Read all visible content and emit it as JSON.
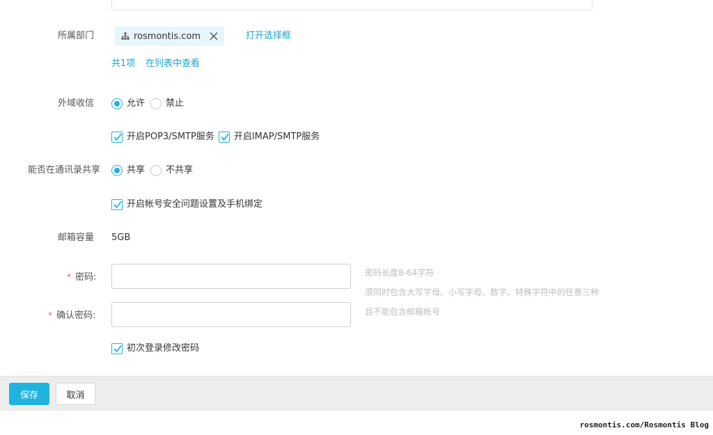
{
  "department": {
    "label": "所属部门",
    "tag_name": "rosmontis.com",
    "open_selector": "打开选择框",
    "count_text": "共1项",
    "view_in_list": "在列表中查看"
  },
  "external_mail": {
    "label": "外域收信",
    "options": [
      "允许",
      "禁止"
    ],
    "selected": "允许",
    "checkboxes": [
      {
        "label": "开启POP3/SMTP服务",
        "checked": true
      },
      {
        "label": "开启IMAP/SMTP服务",
        "checked": true
      }
    ]
  },
  "contacts_share": {
    "label": "能否在通讯录共享",
    "options": [
      "共享",
      "不共享"
    ],
    "selected": "共享",
    "security_checkbox": {
      "label": "开启帐号安全问题设置及手机绑定",
      "checked": true
    }
  },
  "mailbox": {
    "label": "邮箱容量",
    "value": "5GB"
  },
  "password": {
    "label": "密码:",
    "value": "",
    "confirm_label": "确认密码:",
    "confirm_value": "",
    "required_mark": "*",
    "hints": [
      "密码长度8-64字符",
      "须同时包含大写字母、小写字母、数字、特殊字符中的任意三种",
      "且不能包含邮箱帐号"
    ],
    "change_on_first_login": {
      "label": "初次登录修改密码",
      "checked": true
    }
  },
  "footer": {
    "save": "保存",
    "cancel": "取消"
  },
  "watermark": "rosmontis.com/Rosmontis Blog",
  "colors": {
    "accent": "#1fb3df",
    "link": "#1aa6cf",
    "tag_bg": "#e6f6fb",
    "footer_bg": "#ededed"
  }
}
